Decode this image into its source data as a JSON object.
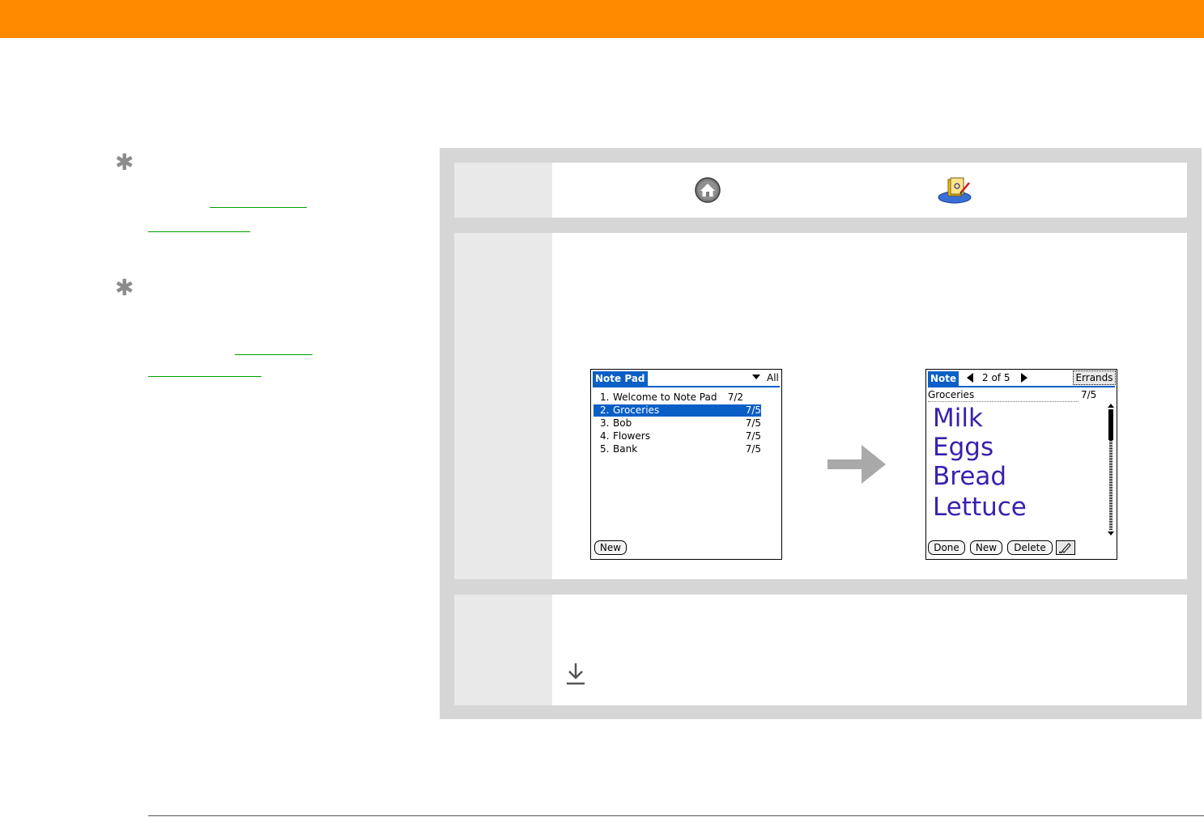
{
  "colors": {
    "header": "#ff8a00",
    "palm_blue": "#0a5fc6",
    "ink": "#3a1fb0",
    "panel": "#d6d6d6"
  },
  "icons": [
    "asterisk-icon",
    "home-icon",
    "note-pad-app-icon",
    "right-arrow-icon",
    "download-arrow-icon"
  ],
  "screen1": {
    "title": "Note Pad",
    "category": "All",
    "notes": [
      {
        "num": "1.",
        "title": "Welcome to Note Pad",
        "date": "7/2"
      },
      {
        "num": "2.",
        "title": "Groceries",
        "date": "7/5"
      },
      {
        "num": "3.",
        "title": "Bob",
        "date": "7/5"
      },
      {
        "num": "4.",
        "title": "Flowers",
        "date": "7/5"
      },
      {
        "num": "5.",
        "title": "Bank",
        "date": "7/5"
      }
    ],
    "new_label": "New"
  },
  "screen2": {
    "title": "Note",
    "position": "2 of 5",
    "category": "Errands",
    "note_title": "Groceries",
    "note_date": "7/5",
    "ink_lines": [
      "Milk",
      "Eggs",
      "Bread",
      "Lettuce"
    ],
    "buttons": {
      "done": "Done",
      "new": "New",
      "delete": "Delete"
    }
  }
}
